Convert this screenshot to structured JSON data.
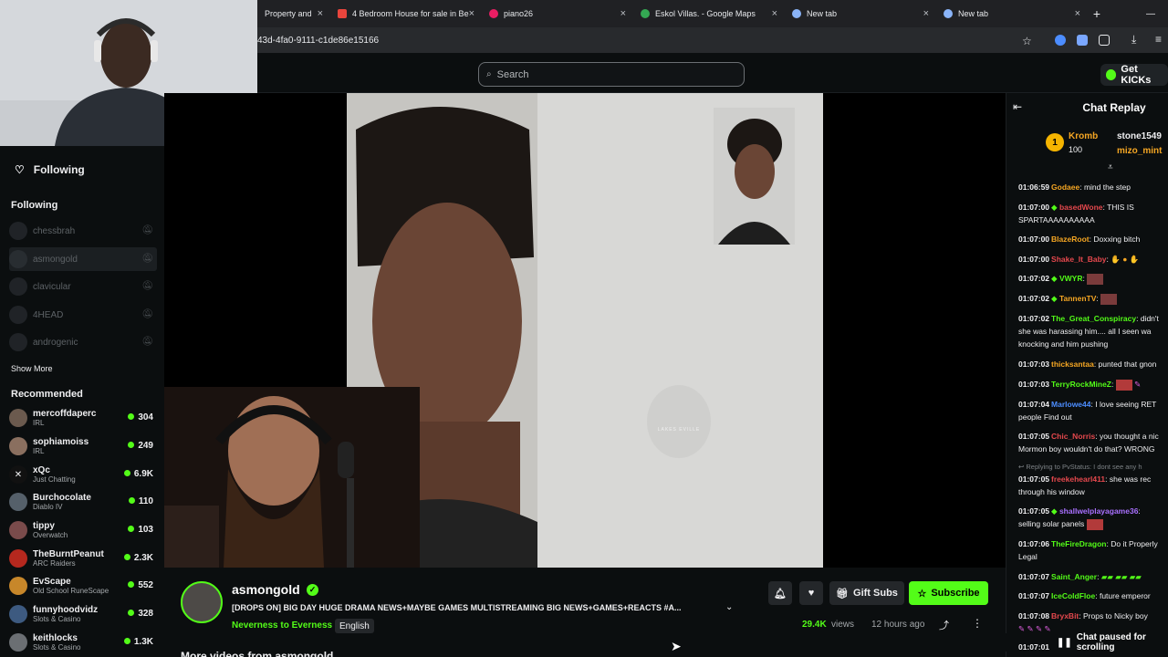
{
  "browser": {
    "tabs": [
      {
        "label": "Property and",
        "color": "#5f6368"
      },
      {
        "label": "4 Bedroom House for sale in Be",
        "color": "#e8453c"
      },
      {
        "label": "piano26",
        "color": "#e91e63"
      },
      {
        "label": "Eskol Villas. - Google Maps",
        "color": "#34a853"
      },
      {
        "label": "New tab",
        "color": "#8ab4f8"
      },
      {
        "label": "New tab",
        "color": "#8ab4f8"
      }
    ],
    "address": "43d-4fa0-9111-c1de86e15166",
    "new_tab": "+",
    "minimize": "—"
  },
  "header": {
    "search_placeholder": "Search",
    "get_kicks": "Get KICKs"
  },
  "sidebar": {
    "following_header": "Following",
    "following_section": "Following",
    "offline": [
      {
        "name": "chessbrah"
      },
      {
        "name": "asmongold"
      },
      {
        "name": "clavicular"
      },
      {
        "name": "4HEAD"
      },
      {
        "name": "androgenic"
      }
    ],
    "show_more": "Show More",
    "recommended_section": "Recommended",
    "recommended": [
      {
        "name": "mercoffdaperc",
        "category": "IRL",
        "viewers": "304"
      },
      {
        "name": "sophiamoiss",
        "category": "IRL",
        "viewers": "249"
      },
      {
        "name": "xQc",
        "category": "Just Chatting",
        "viewers": "6.9K"
      },
      {
        "name": "Burchocolate",
        "category": "Diablo IV",
        "viewers": "110"
      },
      {
        "name": "tippy",
        "category": "Overwatch",
        "viewers": "103"
      },
      {
        "name": "TheBurntPeanut",
        "category": "ARC Raiders",
        "viewers": "2.3K"
      },
      {
        "name": "EvScape",
        "category": "Old School RuneScape",
        "viewers": "552"
      },
      {
        "name": "funnyhoodvidz",
        "category": "Slots & Casino",
        "viewers": "328"
      },
      {
        "name": "keithlocks",
        "category": "Slots & Casino",
        "viewers": "1.3K"
      }
    ]
  },
  "stream": {
    "streamer": "asmongold",
    "title": "[DROPS ON] BIG DAY HUGE DRAMA NEWS+MAYBE GAMES MULTISTREAMING BIG NEWS+GAMES+REACTS #A...",
    "category": "Neverness to Everness",
    "language": "English",
    "gift_subs": "Gift Subs",
    "subscribe": "Subscribe",
    "views_count": "29.4K",
    "views_label": "views",
    "time_ago": "12 hours ago",
    "more_videos": "More videos from asmongold",
    "mugshot_watermark": "LAKES EVILLE"
  },
  "chat": {
    "title": "Chat Replay",
    "pinned": {
      "user1": "Kromb",
      "points": "100",
      "user2": "stone1549",
      "user3": "mizo_mint",
      "badge_num": "1"
    },
    "messages": [
      {
        "time": "01:06:59",
        "user": "Godaee",
        "color": "#f5a623",
        "text": "mind the step"
      },
      {
        "time": "01:07:00",
        "user": "basedWone",
        "color": "#e5484d",
        "text": "THIS IS",
        "cont": "SPARTAAAAAAAAAA"
      },
      {
        "time": "01:07:00",
        "user": "BlazeRoot",
        "color": "#f5a623",
        "text": "Doxxing bitch"
      },
      {
        "time": "01:07:00",
        "user": "Shake_It_Baby",
        "color": "#e5484d",
        "text": ""
      },
      {
        "time": "01:07:02",
        "user": "VWYR",
        "color": "#53fc18",
        "text": ""
      },
      {
        "time": "01:07:02",
        "user": "TannenTV",
        "color": "#f5a623",
        "text": ""
      },
      {
        "time": "01:07:02",
        "user": "The_Great_Conspiracy",
        "color": "#53fc18",
        "text": "didn't",
        "cont": "she was harassing him.... all I seen wa",
        "cont2": "knocking and him pushing"
      },
      {
        "time": "01:07:03",
        "user": "thicksantaa",
        "color": "#f5a623",
        "text": "punted that gnon"
      },
      {
        "time": "01:07:03",
        "user": "TerryRockMineZ",
        "color": "#53fc18",
        "text": ""
      },
      {
        "time": "01:07:04",
        "user": "Marlowe44",
        "color": "#4c8dff",
        "text": "I love seeing RET",
        "cont": "people Find out"
      },
      {
        "time": "01:07:05",
        "user": "Chic_Norris",
        "color": "#e5484d",
        "text": "you thought a nic",
        "cont": "Mormon boy wouldn't do that? WRONG"
      },
      {
        "reply": "Replying to PvStatus: I dont see any h"
      },
      {
        "time": "01:07:05",
        "user": "freekehearl411",
        "color": "#e5484d",
        "text": "she was rec",
        "cont": "through his window"
      },
      {
        "time": "01:07:05",
        "user": "shallwelplayagame36",
        "color": "#a970ff",
        "text": "",
        "cont": "selling solar panels"
      },
      {
        "time": "01:07:06",
        "user": "TheFireDragon",
        "color": "#53fc18",
        "text": "Do it Properly",
        "cont": "Legal"
      },
      {
        "time": "01:07:07",
        "user": "Saint_Anger",
        "color": "#53fc18",
        "text": ""
      },
      {
        "time": "01:07:07",
        "user": "IceColdFloe",
        "color": "#53fc18",
        "text": "future emperor"
      },
      {
        "time": "01:07:08",
        "user": "BryxBit",
        "color": "#e5484d",
        "text": "Props to Nicky boy"
      }
    ],
    "paused": "Chat paused for scrolling",
    "last_time": "01:07:01"
  }
}
